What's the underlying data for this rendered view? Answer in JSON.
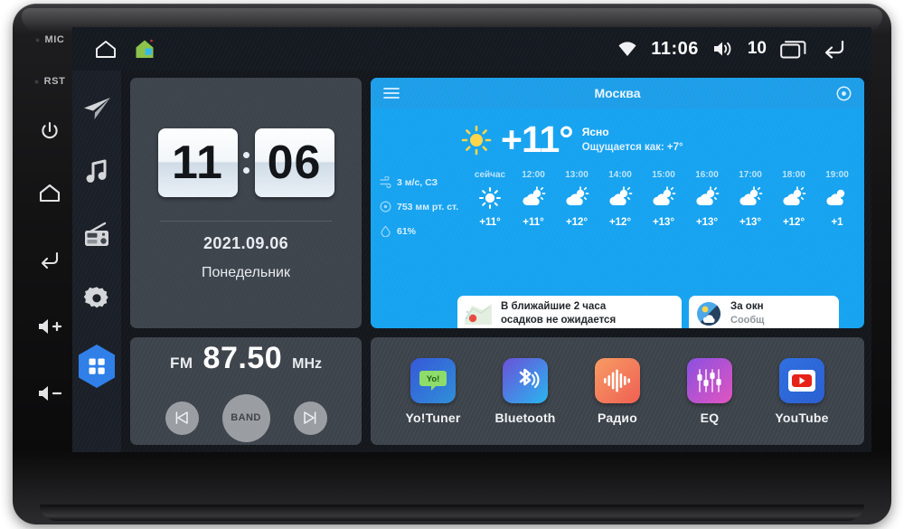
{
  "device": {
    "bezel_keys": [
      {
        "name": "mic",
        "label": "MIC",
        "type": "indicator"
      },
      {
        "name": "reset",
        "label": "RST",
        "type": "indicator"
      },
      {
        "name": "power",
        "label": "",
        "type": "icon"
      },
      {
        "name": "home",
        "label": "",
        "type": "icon"
      },
      {
        "name": "back",
        "label": "",
        "type": "icon"
      },
      {
        "name": "volume-up",
        "label": "",
        "type": "icon"
      },
      {
        "name": "volume-down",
        "label": "",
        "type": "icon"
      }
    ]
  },
  "statusbar": {
    "left_icons": [
      "home-outline-icon",
      "home-color-icon"
    ],
    "wifi_icon": "wifi-icon",
    "time": "11:06",
    "volume_icon": "volume-icon",
    "volume_level": "10",
    "recents_icon": "recents-icon",
    "back_icon": "back-arrow-icon"
  },
  "sidebar": {
    "items": [
      {
        "name": "navigation",
        "icon": "paper-plane-icon"
      },
      {
        "name": "music",
        "icon": "music-note-icon"
      },
      {
        "name": "radio",
        "icon": "radio-icon"
      },
      {
        "name": "settings",
        "icon": "gear-icon"
      },
      {
        "name": "all-apps",
        "icon": "app-grid-icon",
        "accent": "#2f7fe8"
      }
    ]
  },
  "clock_widget": {
    "hours": "11",
    "minutes": "06",
    "date": "2021.09.06",
    "weekday": "Понедельник"
  },
  "radio_widget": {
    "band": "FM",
    "frequency": "87.50",
    "unit": "MHz",
    "prev_label": "prev-station",
    "band_label": "BAND",
    "next_label": "next-station"
  },
  "weather_widget": {
    "menu_icon": "hamburger-icon",
    "city": "Москва",
    "settings_icon": "gear-icon",
    "current_icon": "sun-icon",
    "temperature": "+11°",
    "condition": "Ясно",
    "feels_like": "Ощущается как: +7°",
    "accent": "#17a3f0",
    "stats": [
      {
        "icon": "wind-icon",
        "value": "3 м/с, СЗ"
      },
      {
        "icon": "pressure-icon",
        "value": "753 мм рт. ст."
      },
      {
        "icon": "humidity-icon",
        "value": "61%"
      }
    ],
    "hourly": [
      {
        "label": "сейчас",
        "icon": "sun-icon",
        "temp": "+11°"
      },
      {
        "label": "12:00",
        "icon": "sun-cloud-icon",
        "temp": "+11°"
      },
      {
        "label": "13:00",
        "icon": "sun-cloud-icon",
        "temp": "+12°"
      },
      {
        "label": "14:00",
        "icon": "sun-cloud-icon",
        "temp": "+12°"
      },
      {
        "label": "15:00",
        "icon": "sun-cloud-icon",
        "temp": "+13°"
      },
      {
        "label": "16:00",
        "icon": "sun-cloud-icon",
        "temp": "+13°"
      },
      {
        "label": "17:00",
        "icon": "sun-cloud-icon",
        "temp": "+13°"
      },
      {
        "label": "18:00",
        "icon": "sun-cloud-icon",
        "temp": "+12°"
      },
      {
        "label": "19:00",
        "icon": "sun-cloud-icon",
        "temp": "+1"
      }
    ],
    "cards": [
      {
        "icon": "radar-map-icon",
        "line1": "В ближайшие 2 часа",
        "line2": "осадков не ожидается"
      },
      {
        "icon": "day-night-icon",
        "line1": "За окн",
        "line2": "Сообщ"
      }
    ]
  },
  "apps": [
    {
      "label": "Yo!Tuner",
      "icon": "yotuner-icon",
      "color_from": "#3557d8",
      "color_to": "#2e8fd8"
    },
    {
      "label": "Bluetooth",
      "icon": "bluetooth-icon",
      "color_from": "#6a4fd8",
      "color_to": "#28b6ef"
    },
    {
      "label": "Радио",
      "icon": "radio-wave-icon",
      "color_from": "#f79b63",
      "color_to": "#ef5f52"
    },
    {
      "label": "EQ",
      "icon": "equalizer-icon",
      "color_from": "#8b4fe0",
      "color_to": "#e054c0"
    },
    {
      "label": "YouTube",
      "icon": "youtube-icon",
      "color_from": "#2f6fe0",
      "color_to": "#2a5fd0"
    }
  ]
}
